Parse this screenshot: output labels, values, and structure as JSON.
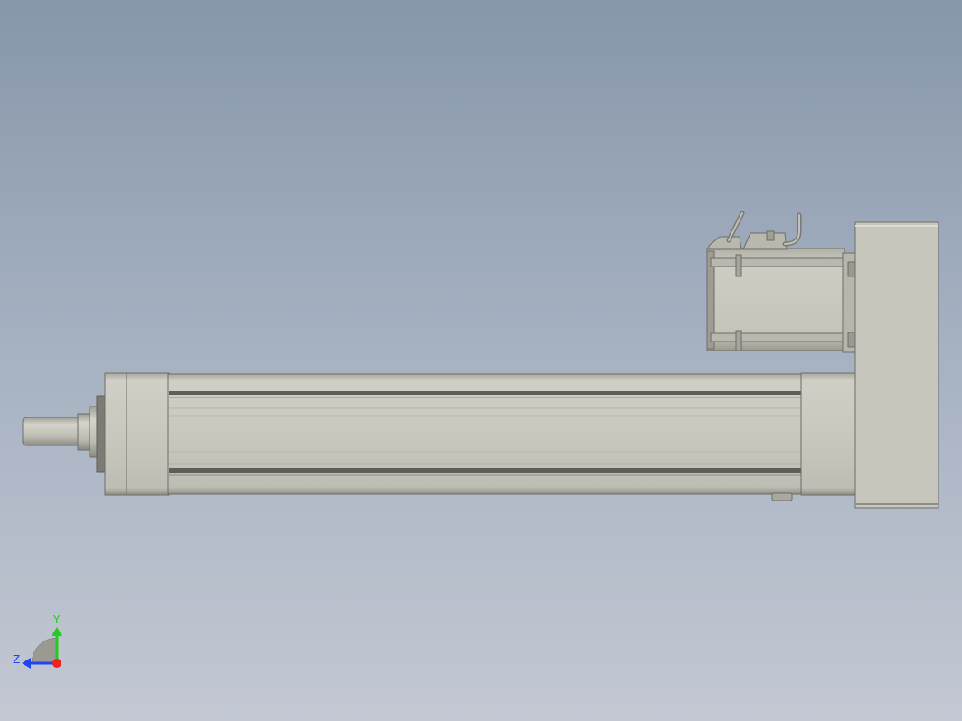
{
  "viewport": {
    "background_top": "#8796aa",
    "background_bottom": "#c3c8d3",
    "model_color": "#c6c6bc"
  },
  "triad": {
    "y_label": "Y",
    "z_label": "Z",
    "y_color": "#22cc22",
    "z_color": "#2244ee",
    "x_color": "#ee2222"
  }
}
